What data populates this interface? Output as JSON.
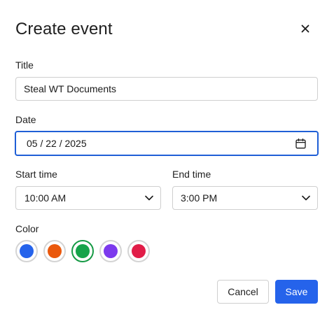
{
  "dialog": {
    "title": "Create event",
    "close_icon": "close-icon"
  },
  "form": {
    "title_label": "Title",
    "title_value": "Steal WT Documents",
    "date_label": "Date",
    "date_value": "05 / 22 / 2025",
    "start_label": "Start time",
    "start_value": "10:00 AM",
    "end_label": "End time",
    "end_value": "3:00 PM",
    "color_label": "Color"
  },
  "colors": {
    "options": [
      "#2563eb",
      "#ea580c",
      "#16a34a",
      "#7c3aed",
      "#e11d48"
    ],
    "selected": "#16a34a"
  },
  "actions": {
    "cancel_label": "Cancel",
    "save_label": "Save"
  },
  "theme": {
    "accent": "#2563eb",
    "focus_border": "#1f5fd6"
  }
}
